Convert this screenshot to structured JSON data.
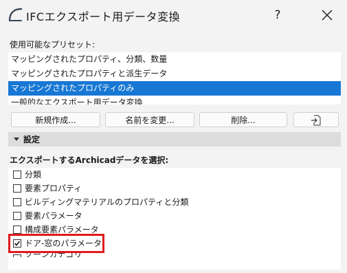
{
  "window": {
    "title": "IFCエクスポート用データ変換",
    "help_label": "?",
    "icon": "archicad-logo-icon",
    "close_icon": "close-icon"
  },
  "presets": {
    "label": "使用可能なプリセット:",
    "items": [
      "マッピングされたプロパティ、分類、数量",
      "マッピングされたプロパティと派生データ",
      "マッピングされたプロパティのみ",
      "一般的なエクスポート用データ変換"
    ],
    "selected_index": 2
  },
  "buttons": {
    "new": "新規作成...",
    "rename": "名前を変更...",
    "delete": "削除...",
    "export_icon": "export-file-icon"
  },
  "settings": {
    "title": "設定",
    "data_label": "エクスポートするArchicadデータを選択:",
    "items": [
      {
        "label": "分類",
        "checked": false
      },
      {
        "label": "要素プロパティ",
        "checked": false
      },
      {
        "label": "ビルディングマテリアルのプロパティと分類",
        "checked": false
      },
      {
        "label": "要素パラメータ",
        "checked": false
      },
      {
        "label": "構成要素パラメータ",
        "checked": false
      },
      {
        "label": "ドア-窓のパラメータ",
        "checked": true
      },
      {
        "label": "ゾーンカテゴリ",
        "checked": false
      }
    ]
  },
  "colors": {
    "selection": "#1777d4",
    "highlight": "#e0191e"
  }
}
